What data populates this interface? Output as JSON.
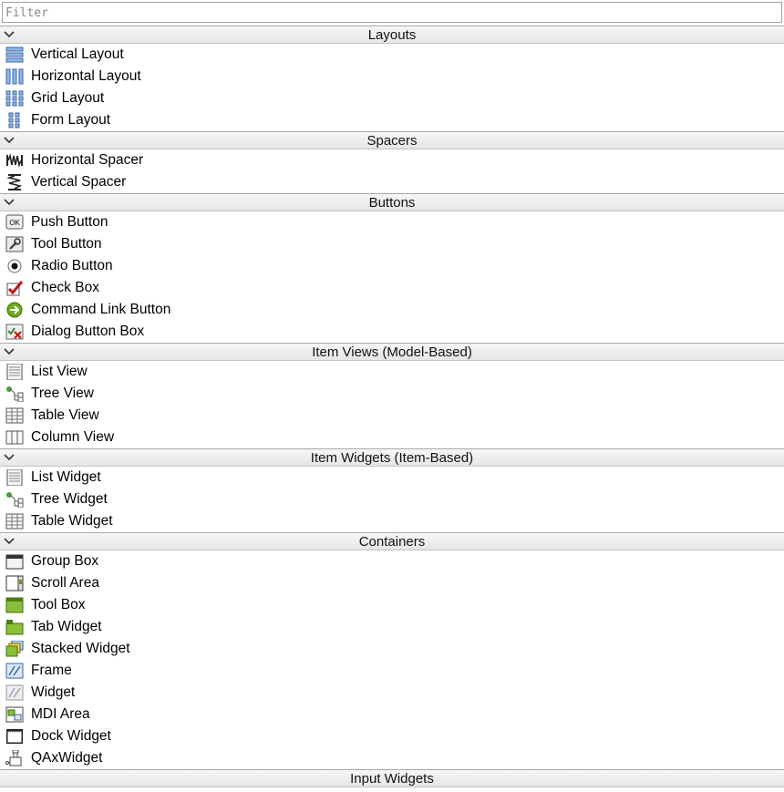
{
  "filter": {
    "placeholder": "Filter",
    "value": ""
  },
  "categories": [
    {
      "title": "Layouts",
      "items": [
        {
          "label": "Vertical Layout",
          "icon": "vertical-layout-icon"
        },
        {
          "label": "Horizontal Layout",
          "icon": "horizontal-layout-icon"
        },
        {
          "label": "Grid Layout",
          "icon": "grid-layout-icon"
        },
        {
          "label": "Form Layout",
          "icon": "form-layout-icon"
        }
      ]
    },
    {
      "title": "Spacers",
      "items": [
        {
          "label": "Horizontal Spacer",
          "icon": "horizontal-spacer-icon"
        },
        {
          "label": "Vertical Spacer",
          "icon": "vertical-spacer-icon"
        }
      ]
    },
    {
      "title": "Buttons",
      "items": [
        {
          "label": "Push Button",
          "icon": "push-button-icon"
        },
        {
          "label": "Tool Button",
          "icon": "tool-button-icon"
        },
        {
          "label": "Radio Button",
          "icon": "radio-button-icon"
        },
        {
          "label": "Check Box",
          "icon": "check-box-icon"
        },
        {
          "label": "Command Link Button",
          "icon": "command-link-button-icon"
        },
        {
          "label": "Dialog Button Box",
          "icon": "dialog-button-box-icon"
        }
      ]
    },
    {
      "title": "Item Views (Model-Based)",
      "items": [
        {
          "label": "List View",
          "icon": "list-view-icon"
        },
        {
          "label": "Tree View",
          "icon": "tree-view-icon"
        },
        {
          "label": "Table View",
          "icon": "table-view-icon"
        },
        {
          "label": "Column View",
          "icon": "column-view-icon"
        }
      ]
    },
    {
      "title": "Item Widgets (Item-Based)",
      "items": [
        {
          "label": "List Widget",
          "icon": "list-widget-icon"
        },
        {
          "label": "Tree Widget",
          "icon": "tree-widget-icon"
        },
        {
          "label": "Table Widget",
          "icon": "table-widget-icon"
        }
      ]
    },
    {
      "title": "Containers",
      "items": [
        {
          "label": "Group Box",
          "icon": "group-box-icon"
        },
        {
          "label": "Scroll Area",
          "icon": "scroll-area-icon"
        },
        {
          "label": "Tool Box",
          "icon": "tool-box-icon"
        },
        {
          "label": "Tab Widget",
          "icon": "tab-widget-icon"
        },
        {
          "label": "Stacked Widget",
          "icon": "stacked-widget-icon"
        },
        {
          "label": "Frame",
          "icon": "frame-icon"
        },
        {
          "label": "Widget",
          "icon": "widget-icon"
        },
        {
          "label": "MDI Area",
          "icon": "mdi-area-icon"
        },
        {
          "label": "Dock Widget",
          "icon": "dock-widget-icon"
        },
        {
          "label": "QAxWidget",
          "icon": "qaxwidget-icon"
        }
      ]
    }
  ],
  "next_category_cut": {
    "title": "Input Widgets"
  }
}
